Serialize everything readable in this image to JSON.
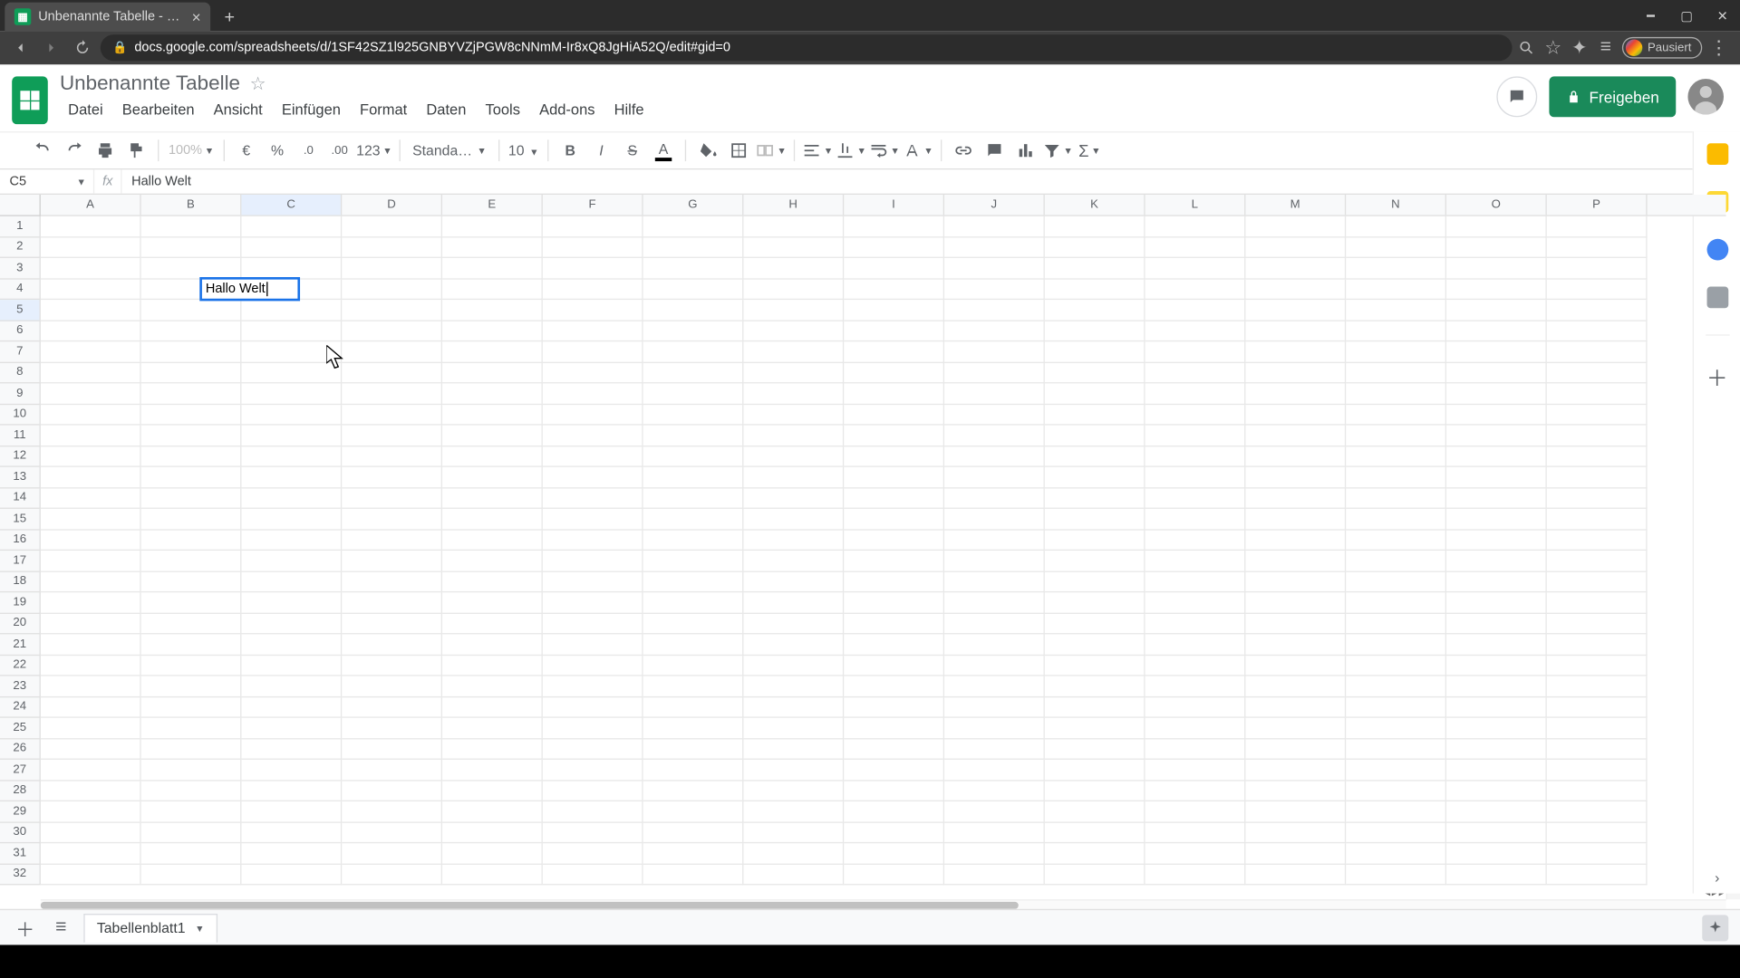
{
  "browser": {
    "tab_title": "Unbenannte Tabelle - Google Ta",
    "url_display": "docs.google.com/spreadsheets/d/1SF42SZ1l925GNBYVZjPGW8cNNmM-Ir8xQ8JgHiA52Q/edit#gid=0",
    "pause_label": "Pausiert"
  },
  "doc": {
    "title": "Unbenannte Tabelle",
    "menus": [
      "Datei",
      "Bearbeiten",
      "Ansicht",
      "Einfügen",
      "Format",
      "Daten",
      "Tools",
      "Add-ons",
      "Hilfe"
    ],
    "share_label": "Freigeben"
  },
  "toolbar": {
    "zoom": "100%",
    "currency": "€",
    "percent": "%",
    "dec_dec": ".0",
    "inc_dec": ".00",
    "numfmt": "123",
    "font": "Standard (...",
    "fontsize": "10"
  },
  "formula": {
    "cell_ref": "C5",
    "value": "Hallo Welt"
  },
  "grid": {
    "columns": [
      "A",
      "B",
      "C",
      "D",
      "E",
      "F",
      "G",
      "H",
      "I",
      "J",
      "K",
      "L",
      "M",
      "N",
      "O",
      "P"
    ],
    "rows": 32,
    "active_col": 2,
    "active_row": 4,
    "edit_value": "Hallo Welt"
  },
  "sheets": {
    "tab1": "Tabellenblatt1"
  }
}
